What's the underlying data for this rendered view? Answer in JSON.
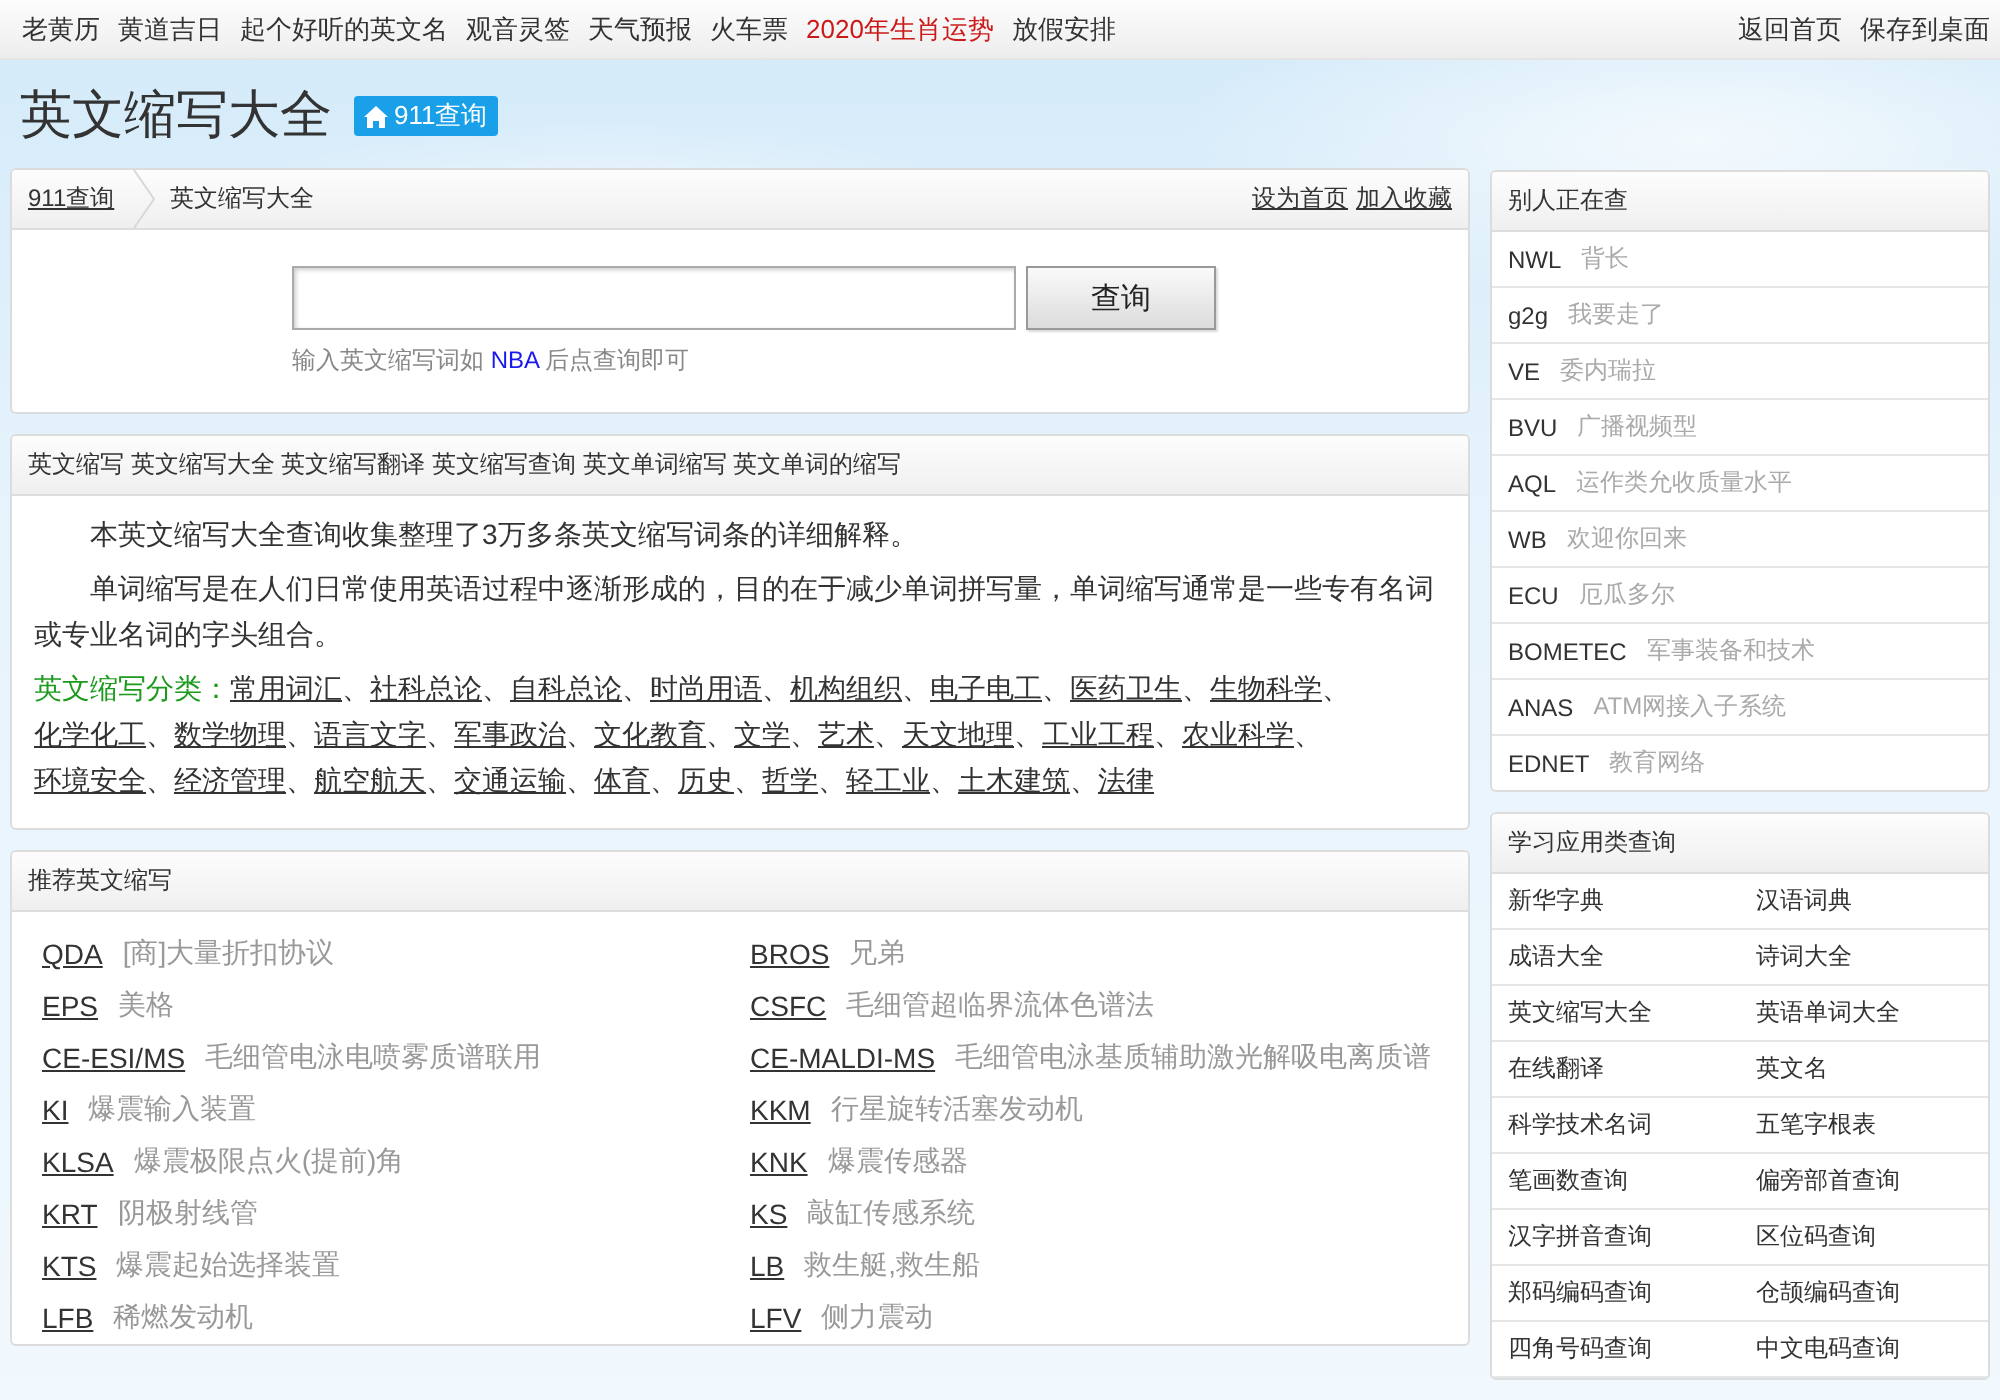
{
  "top_nav": {
    "links": [
      {
        "label": "老黄历",
        "highlight": false
      },
      {
        "label": "黄道吉日",
        "highlight": false
      },
      {
        "label": "起个好听的英文名",
        "highlight": false
      },
      {
        "label": "观音灵签",
        "highlight": false
      },
      {
        "label": "天气预报",
        "highlight": false
      },
      {
        "label": "火车票",
        "highlight": false
      },
      {
        "label": "2020年生肖运势",
        "highlight": true
      },
      {
        "label": "放假安排",
        "highlight": false
      }
    ],
    "right_links": [
      "返回首页",
      "保存到桌面"
    ]
  },
  "header": {
    "title": "英文缩写大全",
    "badge": "911查询"
  },
  "search_panel": {
    "breadcrumb": {
      "home": "911查询",
      "current": "英文缩写大全"
    },
    "actions": [
      "设为首页",
      "加入收藏"
    ],
    "button": "查询",
    "hint": {
      "before": "输入英文缩写词如",
      "example": "NBA",
      "after": "后点查询即可"
    }
  },
  "intro_panel": {
    "title": "英文缩写 英文缩写大全 英文缩写翻译 英文缩写查询 英文单词缩写 英文单词的缩写",
    "paragraphs": [
      "本英文缩写大全查询收集整理了3万多条英文缩写词条的详细解释。",
      "单词缩写是在人们日常使用英语过程中逐渐形成的，目的在于减少单词拼写量，单词缩写通常是一些专有名词或专业名词的字头组合。"
    ],
    "categories": {
      "label": "英文缩写分类：",
      "separator": "、",
      "items": [
        "常用词汇",
        "社科总论",
        "自科总论",
        "时尚用语",
        "机构组织",
        "电子电工",
        "医药卫生",
        "生物科学",
        "化学化工",
        "数学物理",
        "语言文字",
        "军事政治",
        "文化教育",
        "文学",
        "艺术",
        "天文地理",
        "工业工程",
        "农业科学",
        "环境安全",
        "经济管理",
        "航空航天",
        "交通运输",
        "体育",
        "历史",
        "哲学",
        "轻工业",
        "土木建筑",
        "法律"
      ]
    }
  },
  "recommended": {
    "title": "推荐英文缩写",
    "items": [
      {
        "abbr": "QDA",
        "meaning": "[商]大量折扣协议"
      },
      {
        "abbr": "BROS",
        "meaning": "兄弟"
      },
      {
        "abbr": "EPS",
        "meaning": "美格"
      },
      {
        "abbr": "CSFC",
        "meaning": "毛细管超临界流体色谱法"
      },
      {
        "abbr": "CE-ESI/MS",
        "meaning": "毛细管电泳电喷雾质谱联用"
      },
      {
        "abbr": "CE-MALDI-MS",
        "meaning": "毛细管电泳基质辅助激光解吸电离质谱"
      },
      {
        "abbr": "KI",
        "meaning": "爆震输入装置"
      },
      {
        "abbr": "KKM",
        "meaning": "行星旋转活塞发动机"
      },
      {
        "abbr": "KLSA",
        "meaning": "爆震极限点火(提前)角"
      },
      {
        "abbr": "KNK",
        "meaning": "爆震传感器"
      },
      {
        "abbr": "KRT",
        "meaning": "阴极射线管"
      },
      {
        "abbr": "KS",
        "meaning": "敲缸传感系统"
      },
      {
        "abbr": "KTS",
        "meaning": "爆震起始选择装置"
      },
      {
        "abbr": "LB",
        "meaning": "救生艇,救生船"
      },
      {
        "abbr": "LFB",
        "meaning": "稀燃发动机"
      },
      {
        "abbr": "LFV",
        "meaning": "侧力震动"
      }
    ]
  },
  "others_searching": {
    "title": "别人正在查",
    "items": [
      {
        "abbr": "NWL",
        "meaning": "背长"
      },
      {
        "abbr": "g2g",
        "meaning": "我要走了"
      },
      {
        "abbr": "VE",
        "meaning": "委内瑞拉"
      },
      {
        "abbr": "BVU",
        "meaning": "广播视频型"
      },
      {
        "abbr": "AQL",
        "meaning": "运作类允收质量水平"
      },
      {
        "abbr": "WB",
        "meaning": "欢迎你回来"
      },
      {
        "abbr": "ECU",
        "meaning": "厄瓜多尔"
      },
      {
        "abbr": "BOMETEC",
        "meaning": "军事装备和技术"
      },
      {
        "abbr": "ANAS",
        "meaning": "ATM网接入子系统"
      },
      {
        "abbr": "EDNET",
        "meaning": "教育网络"
      }
    ]
  },
  "study_tools": {
    "title": "学习应用类查询",
    "links": [
      "新华字典",
      "汉语词典",
      "成语大全",
      "诗词大全",
      "英文缩写大全",
      "英语单词大全",
      "在线翻译",
      "英文名",
      "科学技术名词",
      "五笔字根表",
      "笔画数查询",
      "偏旁部首查询",
      "汉字拼音查询",
      "区位码查询",
      "郑码编码查询",
      "仓颉编码查询",
      "四角号码查询",
      "中文电码查询"
    ]
  }
}
